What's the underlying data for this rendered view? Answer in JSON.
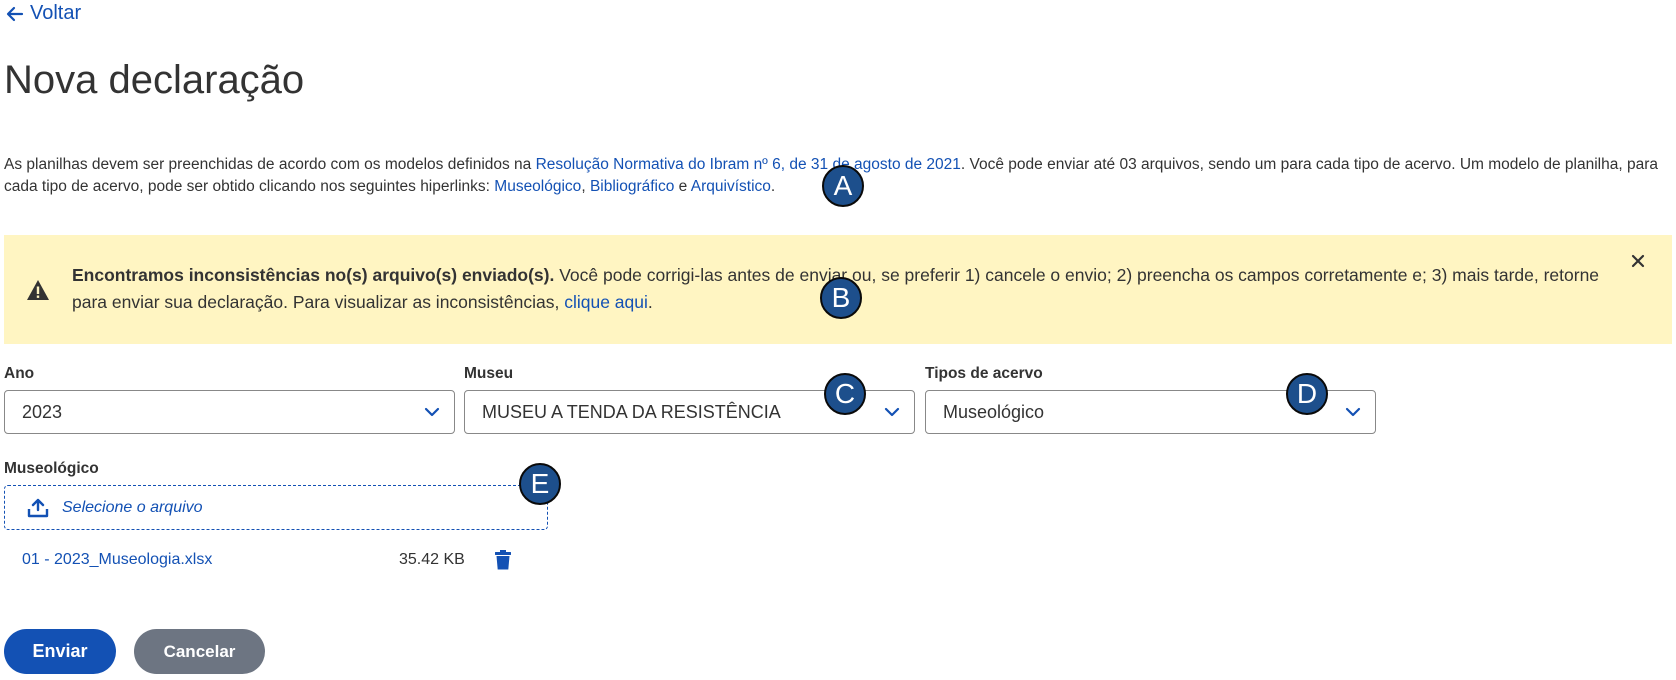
{
  "nav": {
    "back_label": "Voltar"
  },
  "page": {
    "title": "Nova declaração"
  },
  "intro": {
    "text_1": "As planilhas devem ser preenchidas de acordo com os modelos definidos na ",
    "link_resolution": "Resolução Normativa do Ibram nº 6, de 31 de agosto de 2021",
    "text_2": ". Você pode enviar até 03 arquivos, sendo um para cada tipo de acervo. Um modelo de planilha, para cada tipo de acervo, pode ser obtido clicando nos seguintes hiperlinks: ",
    "link_museologico": "Museológico",
    "sep_1": ", ",
    "link_bibliografico": "Bibliográfico",
    "sep_2": " e ",
    "link_arquivistico": "Arquivístico",
    "text_3": "."
  },
  "alert": {
    "bold_text": "Encontramos inconsistências no(s) arquivo(s) enviado(s).",
    "text": " Você pode corrigi-las antes de enviar ou, se preferir 1) cancele o envio; 2) preencha os campos corretamente e; 3) mais tarde, retorne para enviar sua declaração. Para visualizar as inconsistências, ",
    "link": "clique aqui",
    "end": ".",
    "icon": "warning-icon",
    "close_icon": "close-icon"
  },
  "form": {
    "ano": {
      "label": "Ano",
      "value": "2023"
    },
    "museu": {
      "label": "Museu",
      "value": "MUSEU A TENDA DA RESISTÊNCIA"
    },
    "tipos": {
      "label": "Tipos de acervo",
      "value": "Museológico"
    }
  },
  "upload": {
    "label": "Museológico",
    "placeholder": "Selecione o arquivo",
    "file": {
      "name": "01 - 2023_Museologia.xlsx",
      "size": "35.42 KB"
    }
  },
  "actions": {
    "submit": "Enviar",
    "cancel": "Cancelar"
  },
  "markers": [
    "A",
    "B",
    "C",
    "D",
    "E"
  ],
  "colors": {
    "link": "#1351b4",
    "alert_bg": "#fff5c2",
    "secondary_btn": "#6d7582",
    "marker": "#1d4f8c"
  }
}
